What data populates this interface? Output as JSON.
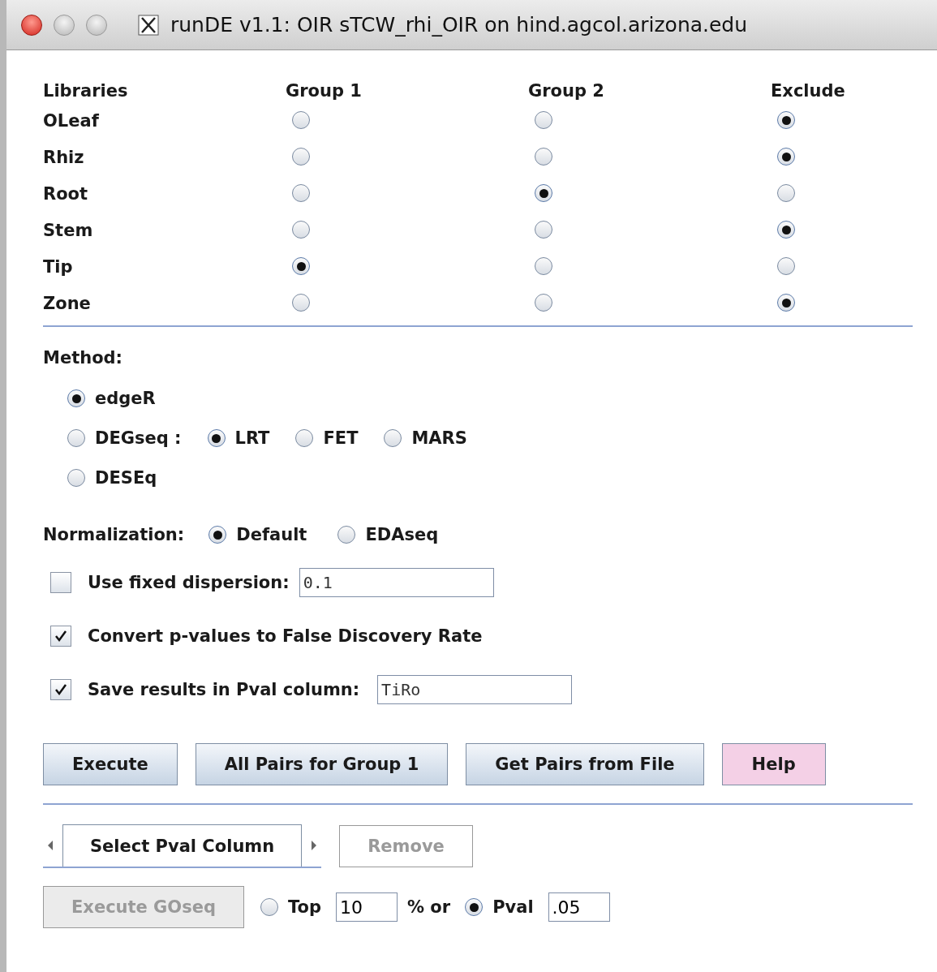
{
  "window": {
    "title": "runDE v1.1: OIR sTCW_rhi_OIR on hind.agcol.arizona.edu"
  },
  "libraries": {
    "columns": [
      "Libraries",
      "Group 1",
      "Group 2",
      "Exclude"
    ],
    "rows": [
      {
        "name": "OLeaf",
        "choices": [
          {
            "selected": false
          },
          {
            "selected": false
          },
          {
            "selected": true
          }
        ]
      },
      {
        "name": "Rhiz",
        "choices": [
          {
            "selected": false
          },
          {
            "selected": false
          },
          {
            "selected": true
          }
        ]
      },
      {
        "name": "Root",
        "choices": [
          {
            "selected": false
          },
          {
            "selected": true
          },
          {
            "selected": false
          }
        ]
      },
      {
        "name": "Stem",
        "choices": [
          {
            "selected": false
          },
          {
            "selected": false
          },
          {
            "selected": true
          }
        ]
      },
      {
        "name": "Tip",
        "choices": [
          {
            "selected": true
          },
          {
            "selected": false
          },
          {
            "selected": false
          }
        ]
      },
      {
        "name": "Zone",
        "choices": [
          {
            "selected": false
          },
          {
            "selected": false
          },
          {
            "selected": true
          }
        ]
      }
    ]
  },
  "method": {
    "label": "Method:",
    "options": [
      {
        "label": "edgeR",
        "selected": true
      },
      {
        "label": "DEGseq :",
        "selected": false,
        "sub_options": [
          {
            "label": "LRT",
            "selected": true
          },
          {
            "label": "FET",
            "selected": false
          },
          {
            "label": "MARS",
            "selected": false
          }
        ]
      },
      {
        "label": "DESEq",
        "selected": false
      }
    ]
  },
  "normalization": {
    "label": "Normalization:",
    "options": [
      {
        "label": "Default",
        "selected": true
      },
      {
        "label": "EDAseq",
        "selected": false
      }
    ]
  },
  "checkboxes": [
    {
      "label": "Use fixed dispersion:",
      "checked": false,
      "value": "0.1"
    },
    {
      "label": "Convert p-values to False Discovery Rate",
      "checked": true
    },
    {
      "label": "Save results in Pval column:",
      "checked": true,
      "value": "TiRo"
    }
  ],
  "buttons": [
    {
      "label": "Execute",
      "kind": "normal"
    },
    {
      "label": "All Pairs for Group 1",
      "kind": "normal"
    },
    {
      "label": "Get Pairs from File",
      "kind": "normal"
    },
    {
      "label": "Help",
      "kind": "help"
    }
  ],
  "pval_selector": {
    "label": "Select Pval Column"
  },
  "remove_button": {
    "label": "Remove",
    "disabled": true
  },
  "goseq": {
    "button": {
      "label": "Execute GOseq",
      "disabled": true
    },
    "top": {
      "label": "Top",
      "selected": false,
      "value": "10"
    },
    "separator": "% or",
    "pval": {
      "label": "Pval",
      "selected": true,
      "value": ".05"
    }
  }
}
